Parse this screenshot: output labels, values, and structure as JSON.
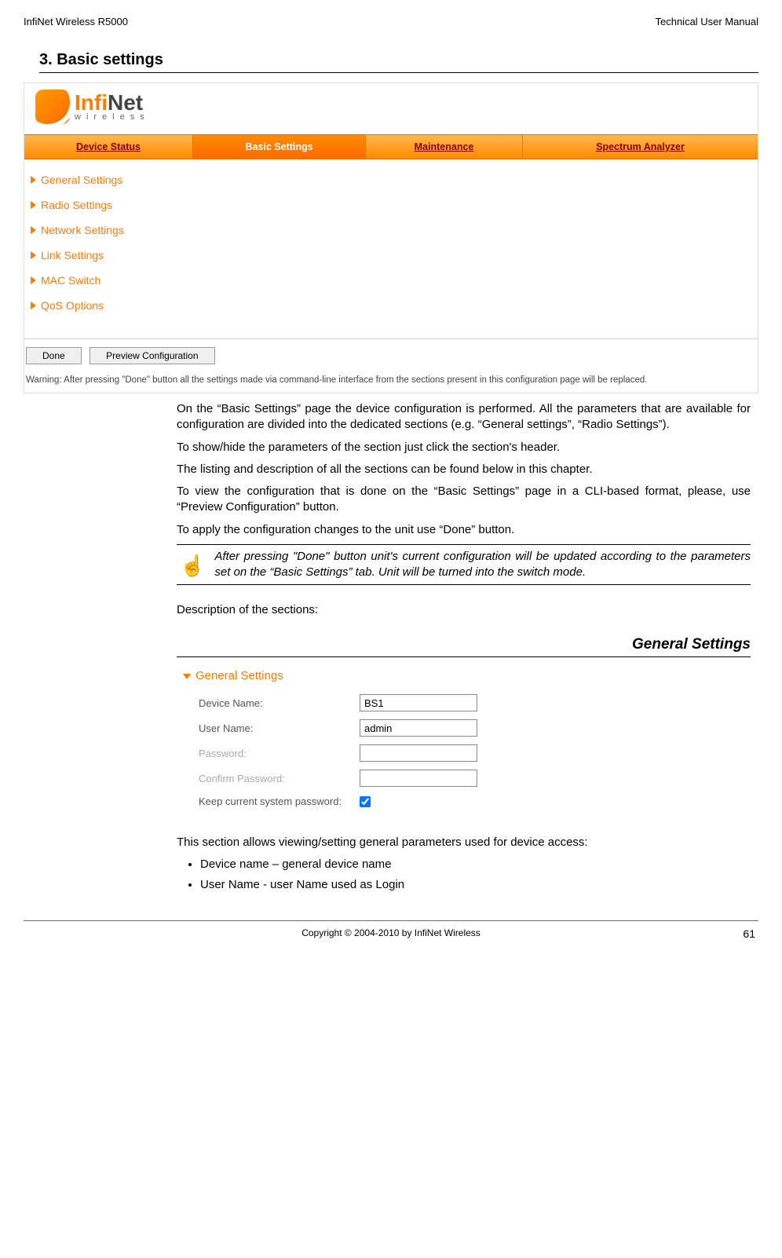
{
  "header": {
    "left": "InfiNet Wireless R5000",
    "right": "Technical User Manual"
  },
  "section_title": "3. Basic settings",
  "logo": {
    "name": "InfiNet",
    "sub": "wireless"
  },
  "tabs": {
    "device_status": "Device Status",
    "basic_settings": "Basic Settings",
    "maintenance": "Maintenance",
    "spectrum": "Spectrum Analyzer"
  },
  "sidebar": {
    "items": [
      "General Settings",
      "Radio Settings",
      "Network Settings",
      "Link Settings",
      "MAC Switch",
      "QoS Options"
    ]
  },
  "buttons": {
    "done": "Done",
    "preview": "Preview Configuration"
  },
  "warning": "Warning: After pressing \"Done\" button all the settings made via command-line interface from the sections present in this configuration page will be replaced.",
  "paras": {
    "p1": "On the “Basic Settings” page the device configuration is performed. All the parameters that are available for configuration are divided into the dedicated sections (e.g. “General settings”, “Radio Settings”).",
    "p2": "To show/hide the parameters of the section just click the section's header.",
    "p3": "The listing and description of all the sections can be found below in this chapter.",
    "p4": "To view the configuration that is done on the “Basic Settings” page in a CLI-based format, please, use “Preview Configuration” button.",
    "p5": "To apply the configuration changes to the unit use “Done” button.",
    "note": "After pressing \"Done\" button unit's current configuration will be updated according to the parameters set on the “Basic Settings” tab. Unit will be turned into the switch mode.",
    "desc": "Description of the sections:"
  },
  "gs": {
    "heading": "General Settings",
    "section_label": "General Settings",
    "rows": {
      "device_name_label": "Device Name:",
      "device_name_value": "BS1",
      "user_name_label": "User Name:",
      "user_name_value": "admin",
      "password_label": "Password:",
      "confirm_label": "Confirm Password:",
      "keep_label": "Keep current system password:"
    },
    "after": "This section allows viewing/setting general parameters used for device access:",
    "bullets": {
      "b1": "Device name – general device name",
      "b2": "User Name - user Name used as Login"
    }
  },
  "footer": {
    "copy": "Copyright © 2004-2010 by InfiNet Wireless",
    "page": "61"
  }
}
